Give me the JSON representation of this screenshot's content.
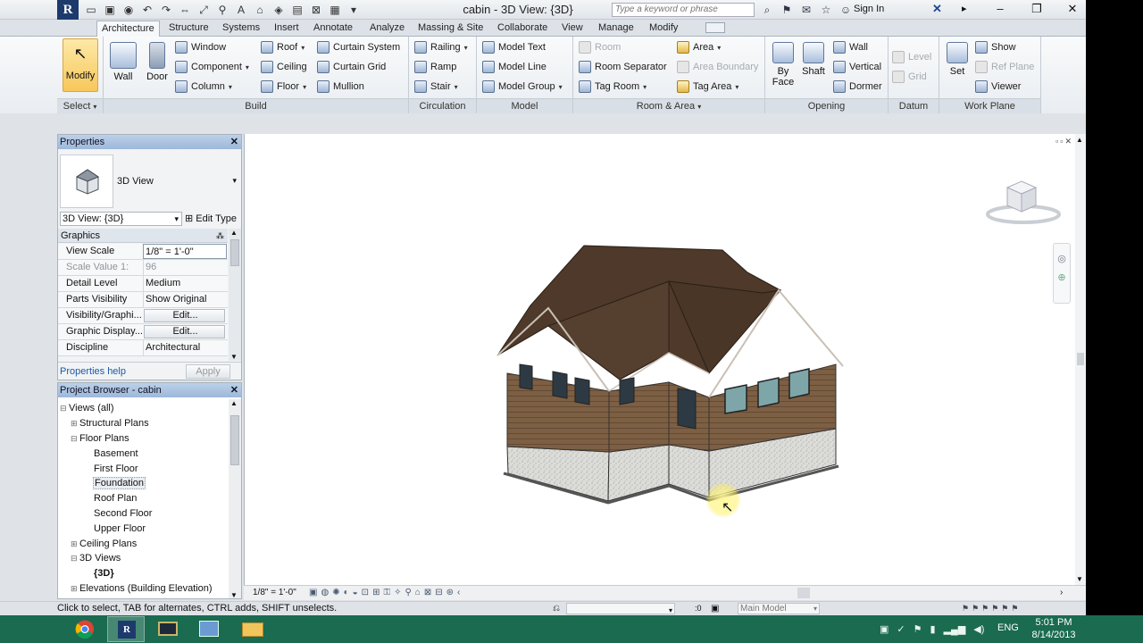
{
  "app": {
    "window_title": "cabin - 3D View: {3D}",
    "search_placeholder": "Type a keyword or phrase",
    "sign_in": "Sign In"
  },
  "tabs": [
    "Architecture",
    "Structure",
    "Systems",
    "Insert",
    "Annotate",
    "Analyze",
    "Massing & Site",
    "Collaborate",
    "View",
    "Manage",
    "Modify"
  ],
  "ribbon": {
    "select": {
      "modify": "Modify",
      "title": "Select"
    },
    "build": {
      "title": "Build",
      "wall": "Wall",
      "door": "Door",
      "window": "Window",
      "component": "Component",
      "column": "Column",
      "roof": "Roof",
      "ceiling": "Ceiling",
      "floor": "Floor",
      "curtain_system": "Curtain System",
      "curtain_grid": "Curtain Grid",
      "mullion": "Mullion"
    },
    "circulation": {
      "title": "Circulation",
      "railing": "Railing",
      "ramp": "Ramp",
      "stair": "Stair"
    },
    "model": {
      "title": "Model",
      "model_text": "Model Text",
      "model_line": "Model Line",
      "model_group": "Model Group"
    },
    "room_area": {
      "title": "Room & Area",
      "room": "Room",
      "room_separator": "Room Separator",
      "tag_room": "Tag Room",
      "area": "Area",
      "area_boundary": "Area Boundary",
      "tag_area": "Tag Area"
    },
    "opening": {
      "title": "Opening",
      "by": "By",
      "face": "Face",
      "shaft": "Shaft",
      "wall": "Wall",
      "vertical": "Vertical",
      "dormer": "Dormer"
    },
    "datum": {
      "title": "Datum",
      "level": "Level",
      "grid": "Grid"
    },
    "work_plane": {
      "title": "Work Plane",
      "set": "Set",
      "show": "Show",
      "ref_plane": "Ref Plane",
      "viewer": "Viewer"
    }
  },
  "properties": {
    "title": "Properties",
    "type_name": "3D View",
    "view_selector": "3D View: {3D}",
    "edit_type": "Edit Type",
    "group": "Graphics",
    "rows": [
      {
        "k": "View Scale",
        "v": "1/8\" = 1'-0\""
      },
      {
        "k": "Scale Value    1:",
        "v": "96"
      },
      {
        "k": "Detail Level",
        "v": "Medium"
      },
      {
        "k": "Parts Visibility",
        "v": "Show Original"
      },
      {
        "k": "Visibility/Graphi...",
        "v": "Edit..."
      },
      {
        "k": "Graphic Display...",
        "v": "Edit..."
      },
      {
        "k": "Discipline",
        "v": "Architectural"
      }
    ],
    "help": "Properties help",
    "apply": "Apply"
  },
  "browser": {
    "title": "Project Browser - cabin",
    "nodes": [
      {
        "label": "Views (all)"
      },
      {
        "label": "Structural Plans"
      },
      {
        "label": "Floor Plans"
      },
      {
        "label": "Basement"
      },
      {
        "label": "First Floor"
      },
      {
        "label": "Foundation"
      },
      {
        "label": "Roof Plan"
      },
      {
        "label": "Second Floor"
      },
      {
        "label": "Upper Floor"
      },
      {
        "label": "Ceiling Plans"
      },
      {
        "label": "3D Views"
      },
      {
        "label": "{3D}"
      },
      {
        "label": "Elevations (Building Elevation)"
      }
    ]
  },
  "viewbar": {
    "scale": "1/8\" = 1'-0\""
  },
  "status": {
    "message": "Click to select, TAB for alternates, CTRL adds, SHIFT unselects.",
    "zero": ":0",
    "model": "Main Model"
  },
  "taskbar": {
    "lang": "ENG",
    "time": "5:01 PM",
    "date": "8/14/2013"
  },
  "colors": {
    "roof": "#4e392a",
    "siding": "#7a5d43",
    "foundation": "#d9d9d6",
    "accent": "#1d3a6c",
    "taskbar": "#1a6b50"
  }
}
